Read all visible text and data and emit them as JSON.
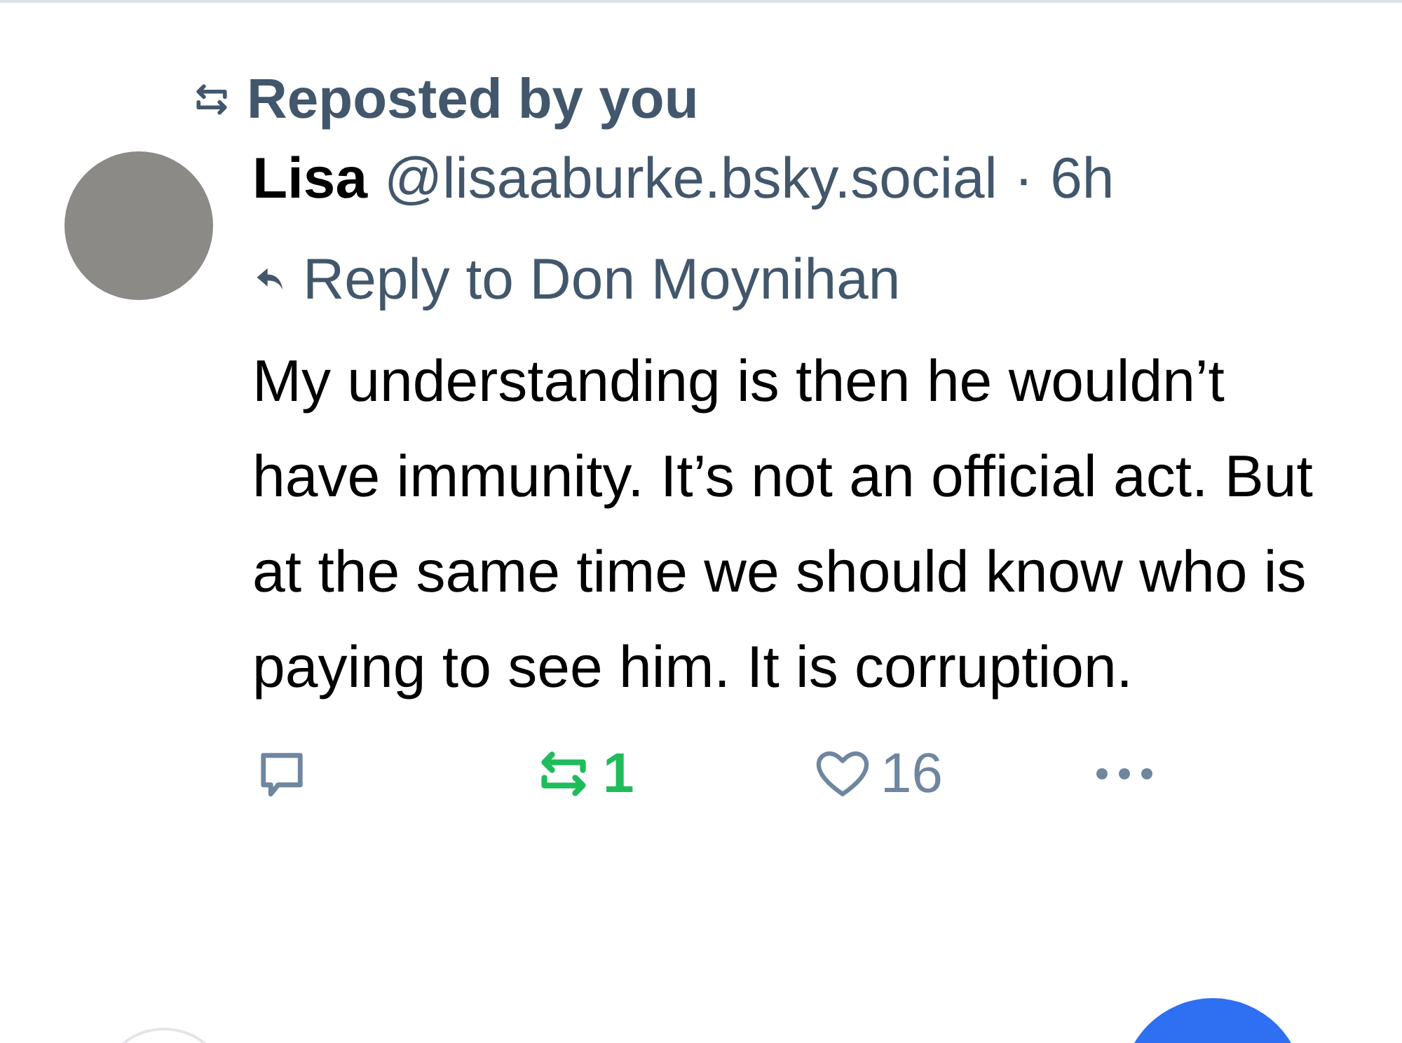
{
  "repost_banner": {
    "label": "Reposted by you"
  },
  "post": {
    "author_name": "Lisa",
    "handle": "@lisaaburke.bsky.social",
    "separator": "·",
    "time": "6h",
    "reply_to": "Reply to Don Moynihan",
    "text": "My understanding is then he wouldn’t have immunity. It’s not an official act. But at the same time we should know who is paying to see him. It is corruption."
  },
  "actions": [
    {
      "kind": "reply"
    },
    {
      "kind": "repost",
      "count": "1",
      "selected": true
    },
    {
      "kind": "like",
      "count": "16",
      "selected": false
    },
    {
      "kind": "more"
    }
  ]
}
